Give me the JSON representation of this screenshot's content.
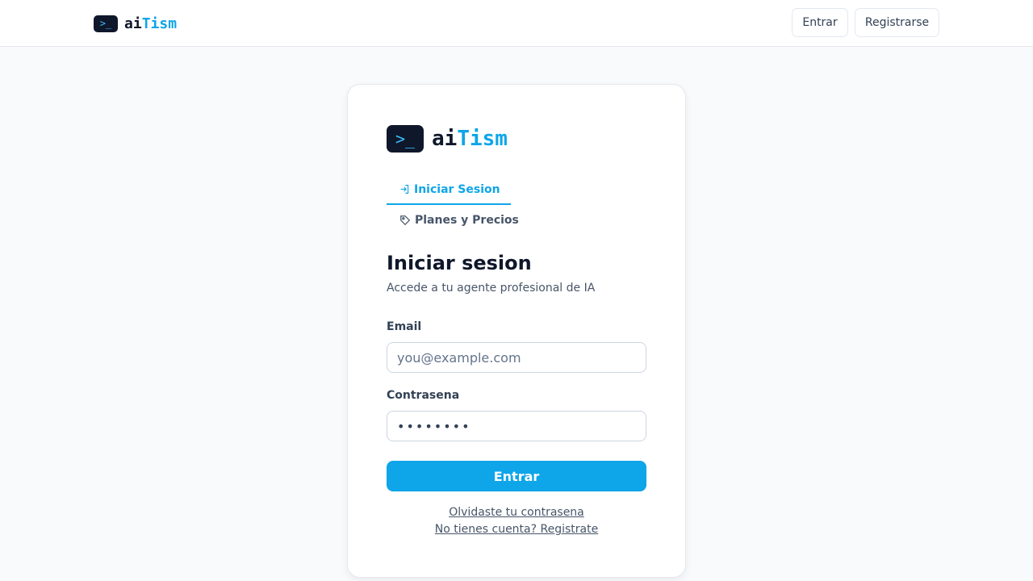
{
  "header": {
    "brand": {
      "logo_glyph": ">_",
      "name_a": "ai",
      "name_b": "Tism"
    },
    "login_label": "Entrar",
    "register_label": "Registrarse"
  },
  "card": {
    "brand": {
      "logo_glyph": ">_",
      "name_a": "ai",
      "name_b": "Tism"
    },
    "tabs": [
      {
        "label": "Iniciar Sesion",
        "icon": "login-icon",
        "active": true
      },
      {
        "label": "Planes y Precios",
        "icon": "tag-icon",
        "active": false
      }
    ],
    "title": "Iniciar sesion",
    "subtitle": "Accede a tu agente profesional de IA",
    "email": {
      "label": "Email",
      "placeholder": "you@example.com",
      "value": ""
    },
    "password": {
      "label": "Contrasena",
      "value": "••••••••"
    },
    "submit_label": "Entrar",
    "forgot_link": "Olvidaste tu contrasena",
    "register_link": "No tienes cuenta? Registrate"
  },
  "colors": {
    "accent": "#0ea5e9",
    "dark": "#0f172a",
    "background": "#f8fafc"
  }
}
